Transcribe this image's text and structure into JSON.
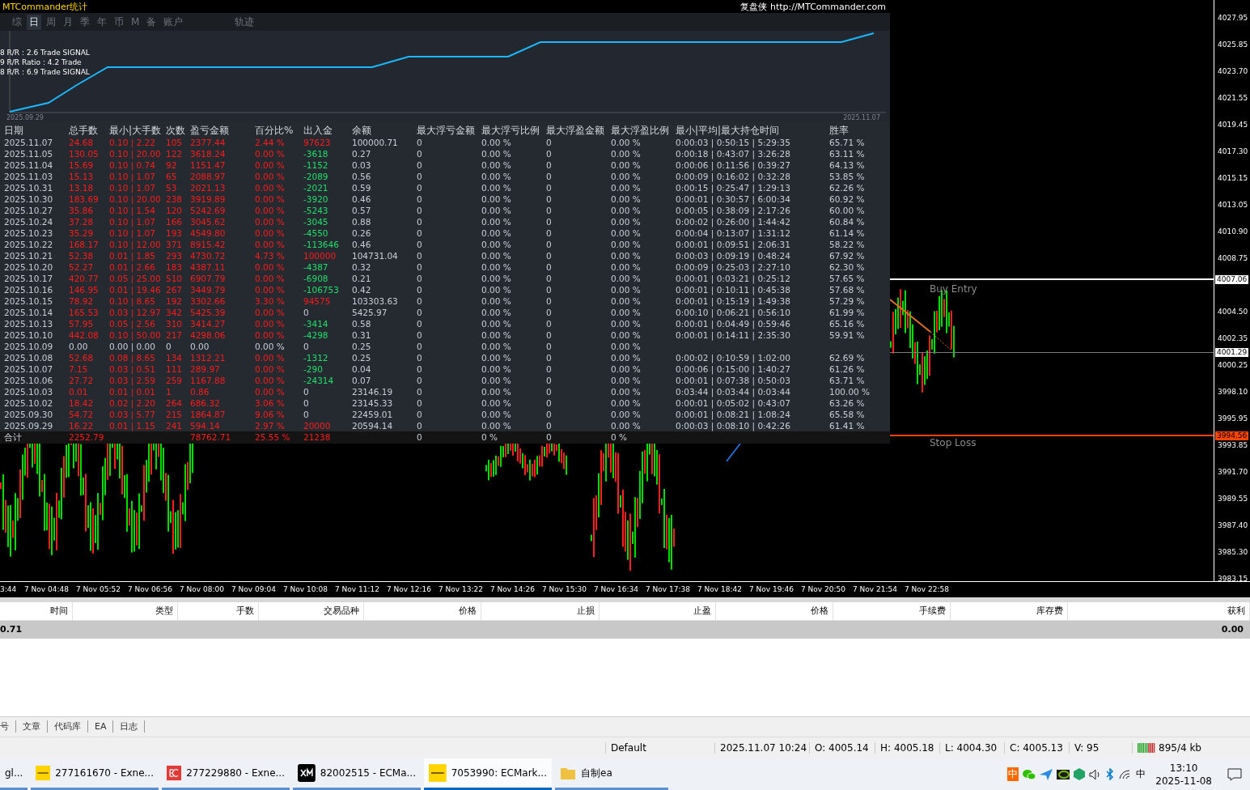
{
  "stats_panel": {
    "title": "MTCommander统计",
    "site_link": "复盘侠 http://MTCommander.com",
    "tabs": [
      {
        "label": "综",
        "kind": "period",
        "selected": false
      },
      {
        "label": "日",
        "kind": "period",
        "selected": true
      },
      {
        "label": "周",
        "kind": "period",
        "selected": false
      },
      {
        "label": "月",
        "kind": "period",
        "selected": false
      },
      {
        "label": "季",
        "kind": "period",
        "selected": false
      },
      {
        "label": "年",
        "kind": "period",
        "selected": false
      },
      {
        "label": "币",
        "kind": "period",
        "selected": false
      },
      {
        "label": "M",
        "kind": "period",
        "selected": false
      },
      {
        "label": "备",
        "kind": "period",
        "selected": false
      },
      {
        "label": "账户",
        "kind": "period",
        "selected": false
      },
      {
        "label": "轨迹",
        "kind": "track",
        "selected": false
      }
    ],
    "equity_chart": {
      "start_label": "2025.09.29",
      "end_label": "2025.11.07",
      "notes": [
        "8 R/R : 2.6  Trade SIGNAL",
        "9 R/R Ratio : 4.2 Trade",
        "8 R/R : 6.9 Trade SIGNAL"
      ]
    },
    "table": {
      "columns": [
        "日期",
        "总手数",
        "最小|大手数",
        "次数",
        "盈亏金额",
        "百分比%",
        "出入金",
        "余额",
        "最大浮亏金额",
        "最大浮亏比例",
        "最大浮盈金额",
        "最大浮盈比例",
        "最小|平均|最大持仓时间",
        "胜率"
      ],
      "rows": [
        {
          "date": "2025.11.07",
          "lots": "24.68",
          "lot_range": "0.10 | 2.22",
          "count": "105",
          "pnl": "2377.44",
          "percent": "2.44 %",
          "flow_amount": "97623",
          "kind": "deposit",
          "balance": "100000.71",
          "max_float_loss": "0",
          "max_float_loss_pct": "0.00 %",
          "max_float_profit": "0",
          "max_float_profit_pct": "0.00 %",
          "hold_times": "0:00:03 | 0:50:15 | 5:29:35",
          "win_rate": "65.71 %",
          "active": true
        },
        {
          "date": "2025.11.05",
          "lots": "130.05",
          "lot_range": "0.10 | 20.00",
          "count": "122",
          "pnl": "3618.24",
          "percent": "0.00 %",
          "flow_amount": "-3618",
          "kind": "withdrawal",
          "balance": "0.27",
          "max_float_loss": "0",
          "max_float_loss_pct": "0.00 %",
          "max_float_profit": "0",
          "max_float_profit_pct": "0.00 %",
          "hold_times": "0:00:18 | 0:43:07 | 3:26:28",
          "win_rate": "63.11 %",
          "active": true
        },
        {
          "date": "2025.11.04",
          "lots": "15.69",
          "lot_range": "0.10 | 0.74",
          "count": "92",
          "pnl": "1151.47",
          "percent": "0.00 %",
          "flow_amount": "-1152",
          "kind": "withdrawal",
          "balance": "0.03",
          "max_float_loss": "0",
          "max_float_loss_pct": "0.00 %",
          "max_float_profit": "0",
          "max_float_profit_pct": "0.00 %",
          "hold_times": "0:00:06 | 0:11:56 | 0:39:27",
          "win_rate": "64.13 %",
          "active": true
        },
        {
          "date": "2025.11.03",
          "lots": "15.13",
          "lot_range": "0.10 | 1.07",
          "count": "65",
          "pnl": "2088.97",
          "percent": "0.00 %",
          "flow_amount": "-2089",
          "kind": "withdrawal",
          "balance": "0.56",
          "max_float_loss": "0",
          "max_float_loss_pct": "0.00 %",
          "max_float_profit": "0",
          "max_float_profit_pct": "0.00 %",
          "hold_times": "0:00:09 | 0:16:02 | 0:32:28",
          "win_rate": "53.85 %",
          "active": true
        },
        {
          "date": "2025.10.31",
          "lots": "13.18",
          "lot_range": "0.10 | 1.07",
          "count": "53",
          "pnl": "2021.13",
          "percent": "0.00 %",
          "flow_amount": "-2021",
          "kind": "withdrawal",
          "balance": "0.59",
          "max_float_loss": "0",
          "max_float_loss_pct": "0.00 %",
          "max_float_profit": "0",
          "max_float_profit_pct": "0.00 %",
          "hold_times": "0:00:15 | 0:25:47 | 1:29:13",
          "win_rate": "62.26 %",
          "active": true
        },
        {
          "date": "2025.10.30",
          "lots": "183.69",
          "lot_range": "0.10 | 20.00",
          "count": "238",
          "pnl": "3919.89",
          "percent": "0.00 %",
          "flow_amount": "-3920",
          "kind": "withdrawal",
          "balance": "0.46",
          "max_float_loss": "0",
          "max_float_loss_pct": "0.00 %",
          "max_float_profit": "0",
          "max_float_profit_pct": "0.00 %",
          "hold_times": "0:00:01 | 0:30:57 | 6:00:34",
          "win_rate": "60.92 %",
          "active": true
        },
        {
          "date": "2025.10.27",
          "lots": "35.86",
          "lot_range": "0.10 | 1.54",
          "count": "120",
          "pnl": "5242.69",
          "percent": "0.00 %",
          "flow_amount": "-5243",
          "kind": "withdrawal",
          "balance": "0.57",
          "max_float_loss": "0",
          "max_float_loss_pct": "0.00 %",
          "max_float_profit": "0",
          "max_float_profit_pct": "0.00 %",
          "hold_times": "0:00:05 | 0:38:09 | 2:17:26",
          "win_rate": "60.00 %",
          "active": true
        },
        {
          "date": "2025.10.24",
          "lots": "37.28",
          "lot_range": "0.10 | 1.07",
          "count": "166",
          "pnl": "3045.62",
          "percent": "0.00 %",
          "flow_amount": "-3045",
          "kind": "withdrawal",
          "balance": "0.88",
          "max_float_loss": "0",
          "max_float_loss_pct": "0.00 %",
          "max_float_profit": "0",
          "max_float_profit_pct": "0.00 %",
          "hold_times": "0:00:02 | 0:26:00 | 1:44:42",
          "win_rate": "60.84 %",
          "active": true
        },
        {
          "date": "2025.10.23",
          "lots": "35.29",
          "lot_range": "0.10 | 1.07",
          "count": "193",
          "pnl": "4549.80",
          "percent": "0.00 %",
          "flow_amount": "-4550",
          "kind": "withdrawal",
          "balance": "0.26",
          "max_float_loss": "0",
          "max_float_loss_pct": "0.00 %",
          "max_float_profit": "0",
          "max_float_profit_pct": "0.00 %",
          "hold_times": "0:00:04 | 0:13:07 | 1:31:12",
          "win_rate": "61.14 %",
          "active": true
        },
        {
          "date": "2025.10.22",
          "lots": "168.17",
          "lot_range": "0.10 | 12.00",
          "count": "371",
          "pnl": "8915.42",
          "percent": "0.00 %",
          "flow_amount": "-113646",
          "kind": "withdrawal",
          "balance": "0.46",
          "max_float_loss": "0",
          "max_float_loss_pct": "0.00 %",
          "max_float_profit": "0",
          "max_float_profit_pct": "0.00 %",
          "hold_times": "0:00:01 | 0:09:51 | 2:06:31",
          "win_rate": "58.22 %",
          "active": true
        },
        {
          "date": "2025.10.21",
          "lots": "52.38",
          "lot_range": "0.01 | 1.85",
          "count": "293",
          "pnl": "4730.72",
          "percent": "4.73 %",
          "flow_amount": "100000",
          "kind": "deposit",
          "balance": "104731.04",
          "max_float_loss": "0",
          "max_float_loss_pct": "0.00 %",
          "max_float_profit": "0",
          "max_float_profit_pct": "0.00 %",
          "hold_times": "0:00:03 | 0:09:19 | 0:48:24",
          "win_rate": "67.92 %",
          "active": true
        },
        {
          "date": "2025.10.20",
          "lots": "52.27",
          "lot_range": "0.01 | 2.66",
          "count": "183",
          "pnl": "4387.11",
          "percent": "0.00 %",
          "flow_amount": "-4387",
          "kind": "withdrawal",
          "balance": "0.32",
          "max_float_loss": "0",
          "max_float_loss_pct": "0.00 %",
          "max_float_profit": "0",
          "max_float_profit_pct": "0.00 %",
          "hold_times": "0:00:09 | 0:25:03 | 2:27:10",
          "win_rate": "62.30 %",
          "active": true
        },
        {
          "date": "2025.10.17",
          "lots": "420.77",
          "lot_range": "0.05 | 25.00",
          "count": "510",
          "pnl": "6907.79",
          "percent": "0.00 %",
          "flow_amount": "-6908",
          "kind": "withdrawal",
          "balance": "0.21",
          "max_float_loss": "0",
          "max_float_loss_pct": "0.00 %",
          "max_float_profit": "0",
          "max_float_profit_pct": "0.00 %",
          "hold_times": "0:00:01 | 0:03:21 | 0:25:12",
          "win_rate": "57.65 %",
          "active": true
        },
        {
          "date": "2025.10.16",
          "lots": "146.95",
          "lot_range": "0.01 | 19.46",
          "count": "267",
          "pnl": "3449.79",
          "percent": "0.00 %",
          "flow_amount": "-106753",
          "kind": "withdrawal",
          "balance": "0.42",
          "max_float_loss": "0",
          "max_float_loss_pct": "0.00 %",
          "max_float_profit": "0",
          "max_float_profit_pct": "0.00 %",
          "hold_times": "0:00:01 | 0:10:11 | 0:45:38",
          "win_rate": "57.68 %",
          "active": true
        },
        {
          "date": "2025.10.15",
          "lots": "78.92",
          "lot_range": "0.10 | 8.65",
          "count": "192",
          "pnl": "3302.66",
          "percent": "3.30 %",
          "flow_amount": "94575",
          "kind": "deposit",
          "balance": "103303.63",
          "max_float_loss": "0",
          "max_float_loss_pct": "0.00 %",
          "max_float_profit": "0",
          "max_float_profit_pct": "0.00 %",
          "hold_times": "0:00:01 | 0:15:19 | 1:49:38",
          "win_rate": "57.29 %",
          "active": true
        },
        {
          "date": "2025.10.14",
          "lots": "165.53",
          "lot_range": "0.03 | 12.97",
          "count": "342",
          "pnl": "5425.39",
          "percent": "0.00 %",
          "flow_amount": "0",
          "kind": "flat",
          "balance": "5425.97",
          "max_float_loss": "0",
          "max_float_loss_pct": "0.00 %",
          "max_float_profit": "0",
          "max_float_profit_pct": "0.00 %",
          "hold_times": "0:00:10 | 0:06:21 | 0:56:10",
          "win_rate": "61.99 %",
          "active": true
        },
        {
          "date": "2025.10.13",
          "lots": "57.95",
          "lot_range": "0.05 | 2.56",
          "count": "310",
          "pnl": "3414.27",
          "percent": "0.00 %",
          "flow_amount": "-3414",
          "kind": "withdrawal",
          "balance": "0.58",
          "max_float_loss": "0",
          "max_float_loss_pct": "0.00 %",
          "max_float_profit": "0",
          "max_float_profit_pct": "0.00 %",
          "hold_times": "0:00:01 | 0:04:49 | 0:59:46",
          "win_rate": "65.16 %",
          "active": true
        },
        {
          "date": "2025.10.10",
          "lots": "442.08",
          "lot_range": "0.10 | 50.00",
          "count": "217",
          "pnl": "4298.06",
          "percent": "0.00 %",
          "flow_amount": "-4298",
          "kind": "withdrawal",
          "balance": "0.31",
          "max_float_loss": "0",
          "max_float_loss_pct": "0.00 %",
          "max_float_profit": "0",
          "max_float_profit_pct": "0.00 %",
          "hold_times": "0:00:01 | 0:14:11 | 2:35:30",
          "win_rate": "59.91 %",
          "active": true
        },
        {
          "date": "2025.10.09",
          "lots": "0.00",
          "lot_range": "0.00 | 0.00",
          "count": "0",
          "pnl": "0.00",
          "percent": "0.00 %",
          "flow_amount": "0",
          "kind": "flat",
          "balance": "0.25",
          "max_float_loss": "0",
          "max_float_loss_pct": "0.00 %",
          "max_float_profit": "0",
          "max_float_profit_pct": "0.00 %",
          "active": false
        },
        {
          "date": "2025.10.08",
          "lots": "52.68",
          "lot_range": "0.08 | 8.65",
          "count": "134",
          "pnl": "1312.21",
          "percent": "0.00 %",
          "flow_amount": "-1312",
          "kind": "withdrawal",
          "balance": "0.25",
          "max_float_loss": "0",
          "max_float_loss_pct": "0.00 %",
          "max_float_profit": "0",
          "max_float_profit_pct": "0.00 %",
          "hold_times": "0:00:02 | 0:10:59 | 1:02:00",
          "win_rate": "62.69 %",
          "active": true
        },
        {
          "date": "2025.10.07",
          "lots": "7.15",
          "lot_range": "0.03 | 0.51",
          "count": "111",
          "pnl": "289.97",
          "percent": "0.00 %",
          "flow_amount": "-290",
          "kind": "withdrawal",
          "balance": "0.04",
          "max_float_loss": "0",
          "max_float_loss_pct": "0.00 %",
          "max_float_profit": "0",
          "max_float_profit_pct": "0.00 %",
          "hold_times": "0:00:06 | 0:15:00 | 1:40:27",
          "win_rate": "61.26 %",
          "active": true
        },
        {
          "date": "2025.10.06",
          "lots": "27.72",
          "lot_range": "0.03 | 2.59",
          "count": "259",
          "pnl": "1167.88",
          "percent": "0.00 %",
          "flow_amount": "-24314",
          "kind": "withdrawal",
          "balance": "0.07",
          "max_float_loss": "0",
          "max_float_loss_pct": "0.00 %",
          "max_float_profit": "0",
          "max_float_profit_pct": "0.00 %",
          "hold_times": "0:00:01 | 0:07:38 | 0:50:03",
          "win_rate": "63.71 %",
          "active": true
        },
        {
          "date": "2025.10.03",
          "lots": "0.01",
          "lot_range": "0.01 | 0.01",
          "count": "1",
          "pnl": "0.86",
          "percent": "0.00 %",
          "flow_amount": "0",
          "kind": "flat",
          "balance": "23146.19",
          "max_float_loss": "0",
          "max_float_loss_pct": "0.00 %",
          "max_float_profit": "0",
          "max_float_profit_pct": "0.00 %",
          "hold_times": "0:03:44 | 0:03:44 | 0:03:44",
          "win_rate": "100.00 %",
          "active": true
        },
        {
          "date": "2025.10.02",
          "lots": "18.42",
          "lot_range": "0.02 | 2.20",
          "count": "264",
          "pnl": "686.32",
          "percent": "3.06 %",
          "flow_amount": "0",
          "kind": "flat",
          "balance": "23145.33",
          "max_float_loss": "0",
          "max_float_loss_pct": "0.00 %",
          "max_float_profit": "0",
          "max_float_profit_pct": "0.00 %",
          "hold_times": "0:00:01 | 0:05:02 | 0:43:07",
          "win_rate": "63.26 %",
          "active": true
        },
        {
          "date": "2025.09.30",
          "lots": "54.72",
          "lot_range": "0.03 | 5.77",
          "count": "215",
          "pnl": "1864.87",
          "percent": "9.06 %",
          "flow_amount": "0",
          "kind": "flat",
          "balance": "22459.01",
          "max_float_loss": "0",
          "max_float_loss_pct": "0.00 %",
          "max_float_profit": "0",
          "max_float_profit_pct": "0.00 %",
          "hold_times": "0:00:01 | 0:08:21 | 1:08:24",
          "win_rate": "65.58 %",
          "active": true
        },
        {
          "date": "2025.09.29",
          "lots": "16.22",
          "lot_range": "0.01 | 1.15",
          "count": "241",
          "pnl": "594.14",
          "percent": "2.97 %",
          "flow_amount": "20000",
          "kind": "deposit",
          "balance": "20594.14",
          "max_float_loss": "0",
          "max_float_loss_pct": "0.00 %",
          "max_float_profit": "0",
          "max_float_profit_pct": "0.00 %",
          "hold_times": "0:00:03 | 0:08:10 | 0:42:26",
          "win_rate": "61.41 %",
          "active": true
        }
      ],
      "total": {
        "label": "合计",
        "lots": "2252.79",
        "pnl": "78762.71",
        "percent": "25.55 %",
        "flow_amount": "21238",
        "max_float_loss": "0",
        "max_float_loss_pct": "0 %",
        "max_float_profit": "0",
        "max_float_profit_pct": "0 %"
      }
    }
  },
  "chart": {
    "lines": [
      {
        "kind": "entry",
        "label": "Buy Entry",
        "price": "4007.06"
      },
      {
        "kind": "current",
        "price": "4001.29"
      },
      {
        "kind": "stop",
        "label": "Stop Loss",
        "price": "3994.56"
      }
    ],
    "price_ticks_upper": [
      "4027.95",
      "4025.85",
      "4023.70",
      "4021.55",
      "4019.45",
      "4017.30",
      "4015.15",
      "4013.05",
      "4010.90",
      "4008.75"
    ],
    "price_ticks_lower": [
      "4004.50",
      "4002.35",
      "4000.25",
      "3998.10",
      "3995.95",
      "3993.85",
      "3991.70",
      "3989.55",
      "3987.40",
      "3985.30",
      "3983.15"
    ],
    "time_ticks": [
      "3:44",
      "7 Nov 04:48",
      "7 Nov 05:52",
      "7 Nov 06:56",
      "7 Nov 08:00",
      "7 Nov 09:04",
      "7 Nov 10:08",
      "7 Nov 11:12",
      "7 Nov 12:16",
      "7 Nov 13:22",
      "7 Nov 14:26",
      "7 Nov 15:30",
      "7 Nov 16:34",
      "7 Nov 17:38",
      "7 Nov 18:42",
      "7 Nov 19:46",
      "7 Nov 20:50",
      "7 Nov 21:54",
      "7 Nov 22:58"
    ]
  },
  "trade_table": {
    "columns": [
      "时间",
      "类型",
      "手数",
      "交易品种",
      "价格",
      "止损",
      "止盈",
      "价格",
      "手续费",
      "库存费",
      "获利"
    ],
    "summary": {
      "column_1": "0.71",
      "profit": "0.00"
    }
  },
  "bottom_tabs": [
    "号",
    "文章",
    "代码库",
    "EA",
    "日志"
  ],
  "status_bar": {
    "profile": "Default",
    "datetime": "2025.11.07 10:24",
    "open": "O: 4005.14",
    "high": "H: 4005.18",
    "low": "L: 4004.30",
    "close": "C: 4005.13",
    "volume": "V: 95",
    "traffic": "895/4 kb"
  },
  "taskbar": {
    "items": [
      {
        "label": "gl...",
        "kind": "none",
        "selected": false
      },
      {
        "label": "277161670 - Exne...",
        "kind": "exness",
        "selected": false
      },
      {
        "label": "277229880 - Exne...",
        "kind": "ec",
        "selected": false
      },
      {
        "label": "82002515 - ECMa...",
        "kind": "xm",
        "selected": false
      },
      {
        "label": "7053990: ECMark...",
        "kind": "exness",
        "selected": true
      },
      {
        "label": "自制ea",
        "kind": "folder",
        "selected": false
      }
    ],
    "tray": [
      {
        "kind": "app-text",
        "label": "中"
      },
      {
        "kind": "chat"
      },
      {
        "kind": "send"
      },
      {
        "kind": "gpu"
      },
      {
        "kind": "hexagon"
      },
      {
        "kind": "speaker"
      },
      {
        "kind": "bluetooth"
      },
      {
        "kind": "network"
      },
      {
        "kind": "ime-text",
        "label": "中"
      }
    ],
    "time": "13:10",
    "date": "2025-11-08"
  }
}
